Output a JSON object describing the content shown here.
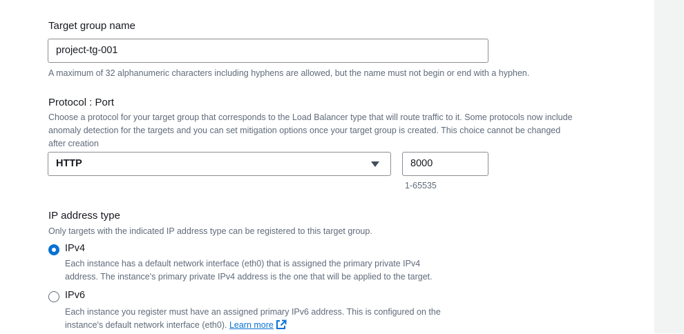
{
  "target_group_name": {
    "label": "Target group name",
    "value": "project-tg-001",
    "hint": "A maximum of 32 alphanumeric characters including hyphens are allowed, but the name must not begin or end with a hyphen."
  },
  "protocol_port": {
    "label": "Protocol : Port",
    "description_lines": [
      "Choose a protocol for your target group that corresponds to the Load Balancer type that will route traffic to it. Some protocols now include",
      "anomaly detection for the targets and you can set mitigation options once your target group is created. This choice cannot be changed",
      "after creation"
    ],
    "protocol_value": "HTTP",
    "port_value": "8000",
    "port_hint": "1-65535"
  },
  "ip_address_type": {
    "label": "IP address type",
    "description": "Only targets with the indicated IP address type can be registered to this target group.",
    "options": [
      {
        "label": "IPv4",
        "checked": true,
        "description_lines": [
          "Each instance has a default network interface (eth0) that is assigned the primary private IPv4",
          "address. The instance's primary private IPv4 address is the one that will be applied to the target."
        ]
      },
      {
        "label": "IPv6",
        "checked": false,
        "description_lines": [
          "Each instance you register must have an assigned primary IPv6 address. This is configured on the",
          "instance's default network interface (eth0)."
        ],
        "link_text": "Learn more"
      }
    ]
  },
  "icons": {
    "external_link": "external-link-icon",
    "dropdown": "caret-down-icon"
  },
  "colors": {
    "accent": "#0972d3",
    "side_panel": "#f2f3f3"
  }
}
